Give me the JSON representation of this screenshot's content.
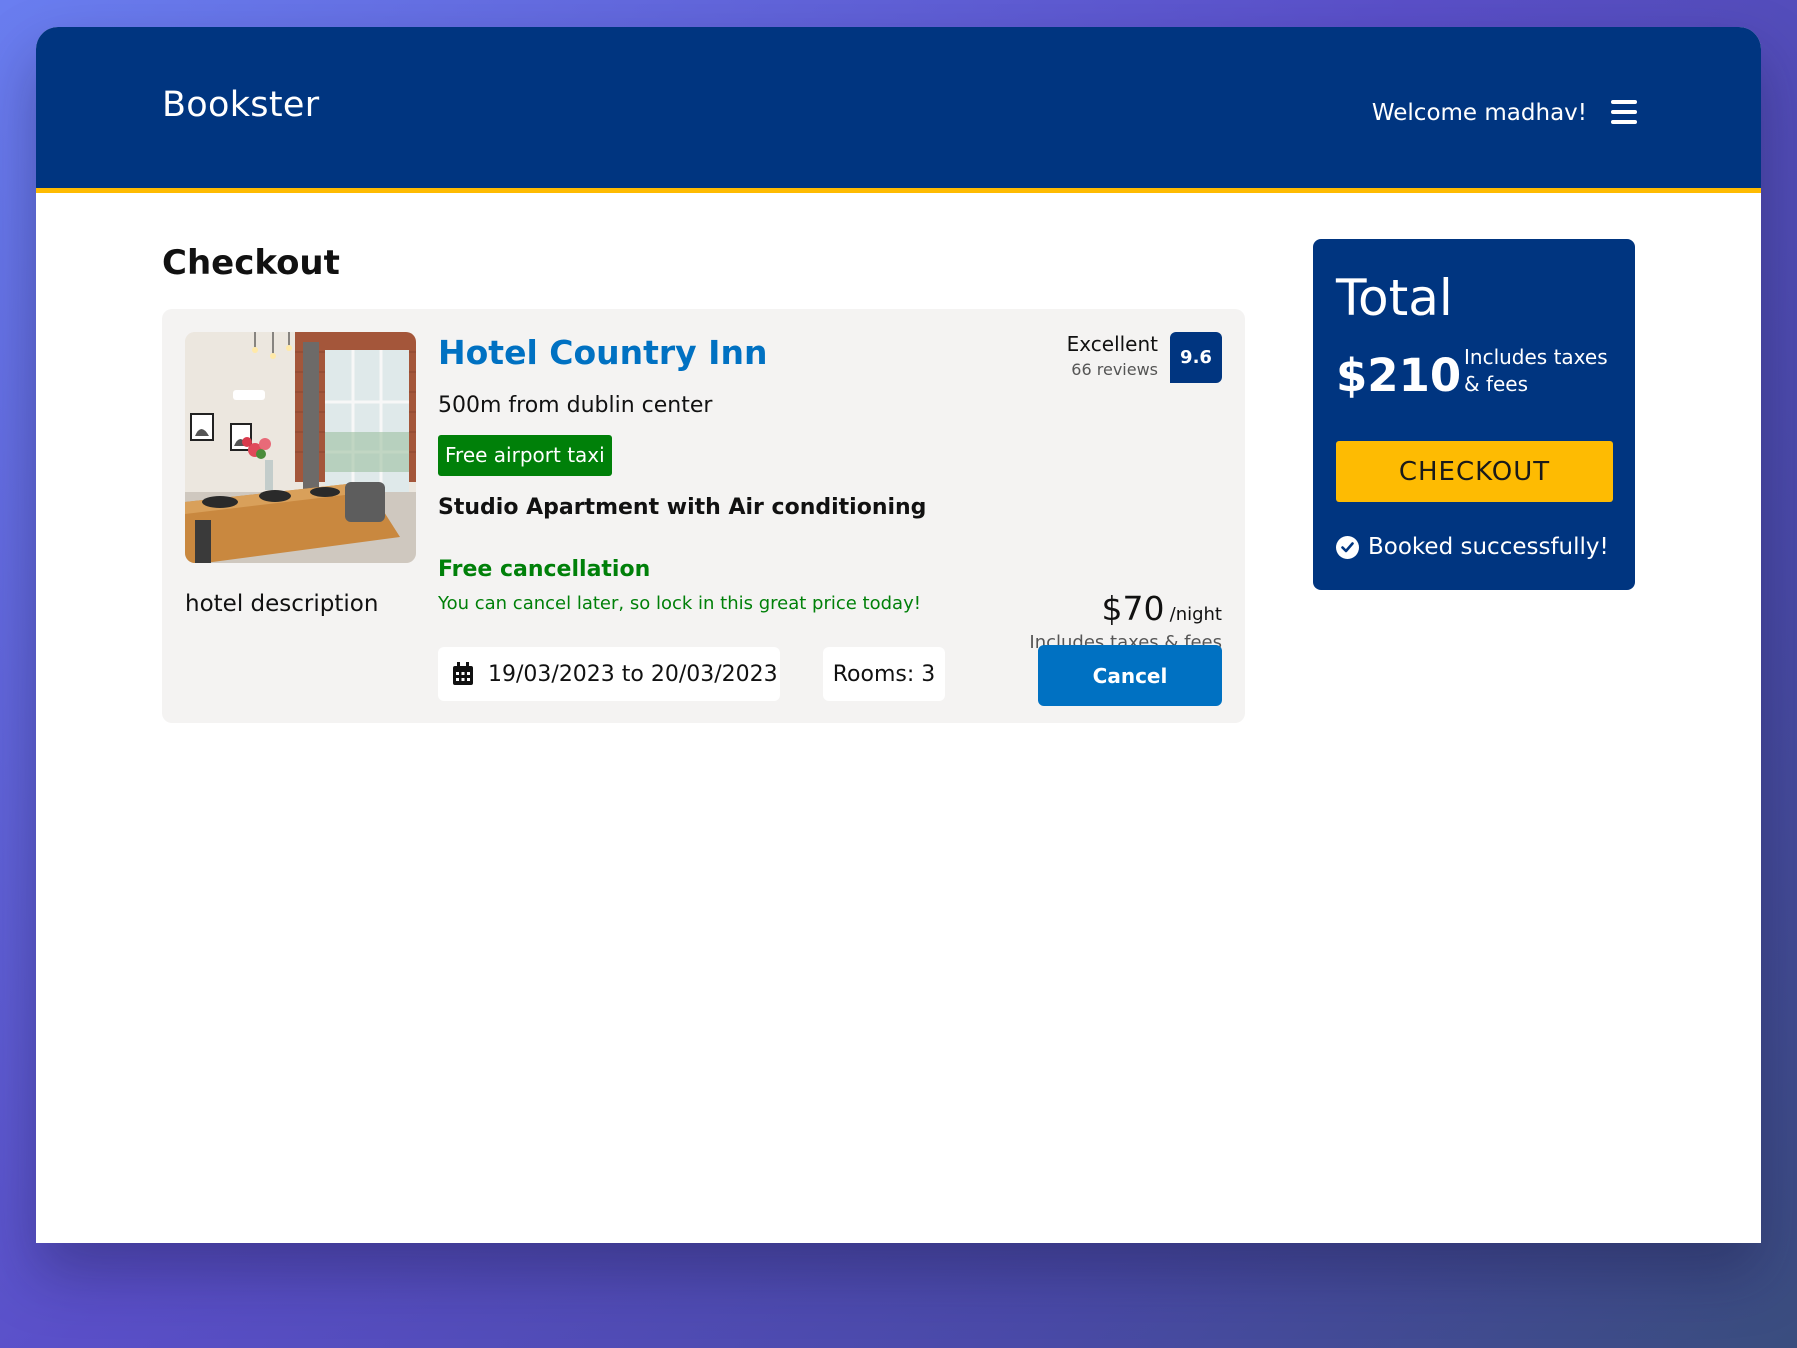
{
  "header": {
    "brand": "Bookster",
    "welcome": "Welcome madhav!",
    "menu_icon": "hamburger-menu-icon"
  },
  "page": {
    "title": "Checkout"
  },
  "hotel": {
    "name": "Hotel Country Inn",
    "distance": "500m from dublin center",
    "taxi_badge": "Free airport taxi",
    "room_type": "Studio Apartment with Air conditioning",
    "free_cancellation": "Free cancellation",
    "cancellation_note": "You can cancel later, so lock in this great price today!",
    "description": "hotel description",
    "dates": "19/03/2023 to 20/03/2023",
    "date_icon": "calendar-icon",
    "rooms": "Rooms: 3",
    "rating_word": "Excellent",
    "reviews": "66 reviews",
    "score": "9.6",
    "price": "$70",
    "price_unit": "/night",
    "price_note": "Includes taxes & fees",
    "cancel_label": "Cancel"
  },
  "summary": {
    "title": "Total",
    "amount": "$210",
    "note": "Includes taxes & fees",
    "checkout_label": "CHECKOUT",
    "status": "Booked successfully!",
    "status_icon": "check-circle-icon"
  },
  "colors": {
    "primary": "#003580",
    "accent": "#febb02",
    "link": "#0071c2",
    "success": "#008009"
  }
}
